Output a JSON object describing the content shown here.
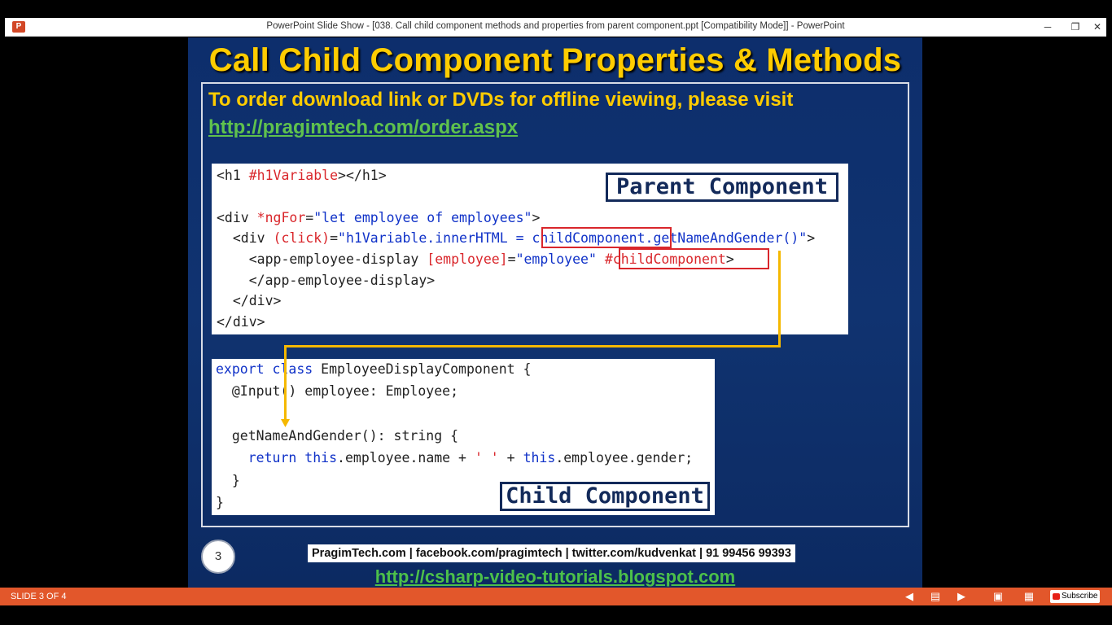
{
  "window": {
    "app_icon": "P",
    "title": "PowerPoint Slide Show - [038. Call child component methods and properties from parent component.ppt [Compatibility Mode]] - PowerPoint",
    "minimize": "─",
    "restore": "❐",
    "close": "✕"
  },
  "slide": {
    "title": "Call Child Component Properties & Methods",
    "order_text": "To order download link or DVDs for offline viewing, please visit",
    "order_link": "http://pragimtech.com/order.aspx",
    "parent_code": {
      "l1_a": "<h1 ",
      "l1_b": "#h1Variable",
      "l1_c": "></h1>",
      "l2_a": "<div ",
      "l2_b": "*ngFor",
      "l2_c": "=",
      "l2_d": "\"let employee of employees\"",
      "l2_e": ">",
      "l3_a": "  <div ",
      "l3_b": "(click)",
      "l3_c": "=",
      "l3_d": "\"h1Variable.innerHTML = ",
      "l3_e": "childComponent",
      "l3_f": ".getNameAndGender()\"",
      "l3_g": ">",
      "l4_a": "    <app-employee-display ",
      "l4_b": "[employee]",
      "l4_c": "=",
      "l4_d": "\"employee\"",
      "l4_e": " ",
      "l4_f": "#childComponent",
      "l4_g": ">",
      "l5": "    </app-employee-display>",
      "l6": "  </div>",
      "l7": "</div>"
    },
    "parent_label": "Parent Component",
    "child_code": {
      "l1_a": "export",
      "l1_b": " ",
      "l1_c": "class",
      "l1_d": " EmployeeDisplayComponent {",
      "l2": "  @Input() employee: Employee;",
      "l3": "  getNameAndGender(): string {",
      "l4_a": "    ",
      "l4_b": "return",
      "l4_c": " ",
      "l4_d": "this",
      "l4_e": ".employee.name + ",
      "l4_f": "' '",
      "l4_g": " + ",
      "l4_h": "this",
      "l4_i": ".employee.gender;",
      "l5": "  }",
      "l6": "}"
    },
    "child_label": "Child Component",
    "slide_number": "3",
    "footer_contacts": "PragimTech.com | facebook.com/pragimtech | twitter.com/kudvenkat | 91 99456 99393",
    "footer_link": "http://csharp-video-tutorials.blogspot.com"
  },
  "statusbar": {
    "slide_count": "SLIDE 3 OF 4",
    "icons": [
      "previous-icon",
      "notes-icon",
      "next-icon",
      "normal-view-icon",
      "slide-sorter-icon",
      "reading-view-icon"
    ],
    "subscribe": "Subscribe"
  },
  "colors": {
    "slide_bg": "#0d2e6c",
    "title": "#ffcc00",
    "link": "#5fc24d",
    "highlight": "#d9262b",
    "arrow": "#f5b800",
    "statusbar": "#e2572b"
  }
}
